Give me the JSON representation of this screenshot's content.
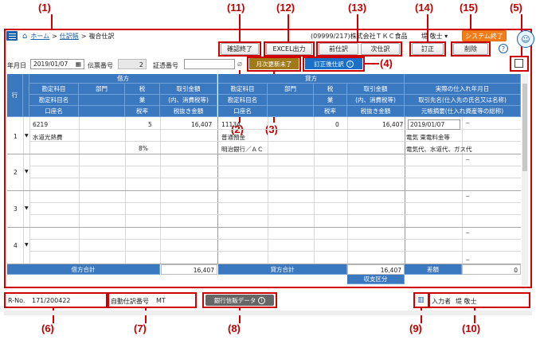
{
  "callouts": [
    "(1)",
    "(2)",
    "(3)",
    "(4)",
    "(5)",
    "(6)",
    "(7)",
    "(8)",
    "(9)",
    "(10)",
    "(11)",
    "(12)",
    "(13)",
    "(14)",
    "(15)"
  ],
  "breadcrumb": {
    "home": "ホーム",
    "journal": "仕訳帳",
    "current": "複合仕訳",
    "separator": ">"
  },
  "company": "(09999/217)株式会社ＴＫＣ食品",
  "user_menu": "堤 敬士 ▾",
  "toolbar": {
    "end_confirm": "確認終了",
    "excel": "EXCEL出力",
    "prev": "前仕訳",
    "next": "次仕訳",
    "correct": "訂正",
    "delete": "削除",
    "system_end": "システム終了"
  },
  "form": {
    "date_label": "年月日",
    "date_value": "2019/01/07",
    "slip_label": "伝票番号",
    "slip_value": "2",
    "voucher_label": "証憑番号",
    "monthly_badge": "月次更新未了",
    "corrected_badge": "訂正後仕訳"
  },
  "headers": {
    "row": "行",
    "debit": "借方",
    "credit": "貸方",
    "account": "勘定科目",
    "account_name": "勘定科目名",
    "bank_account": "口座名",
    "dept": "部門",
    "tax": "税",
    "tax_industry": "業",
    "tax_rate": "税率",
    "amount": "取引金額",
    "amount_incl": "(内、消費税等)",
    "amount_excl": "税抜き金額",
    "purchase_date": "実際の仕入れ年月日",
    "supplier": "取引先名(仕入先の氏名又は名称)",
    "summary": "元帳摘要(仕入れ資産等の総称)"
  },
  "rows": [
    {
      "no": "1",
      "debit_code": "6219",
      "debit_name": "水道光熱費",
      "debit_tax": "5",
      "debit_rate": "8%",
      "debit_amount": "16,407",
      "credit_code": "1113A",
      "credit_name": "普通預金",
      "credit_bank": "明治銀行／ＡＣ",
      "credit_tax": "0",
      "credit_amount": "16,407",
      "date": "2019/01/07",
      "supplier": "電気 東電料金等",
      "summary": "電気代、水道代、ガス代"
    },
    {
      "no": "2"
    },
    {
      "no": "3"
    },
    {
      "no": "4"
    }
  ],
  "totals": {
    "debit_label": "借方合計",
    "debit_value": "16,407",
    "credit_label": "貸方合計",
    "credit_value": "16,407",
    "diff_label": "差額",
    "diff_value": "0",
    "balance_label": "収支区分"
  },
  "footer": {
    "rno_label": "R-No.",
    "rno_value": "171/200422",
    "auto_label": "自動仕訳番号",
    "auto_value": "MT",
    "bank_button": "銀行信販データ",
    "inputter_label": "入力者",
    "inputter_value": "堤 敬士"
  }
}
